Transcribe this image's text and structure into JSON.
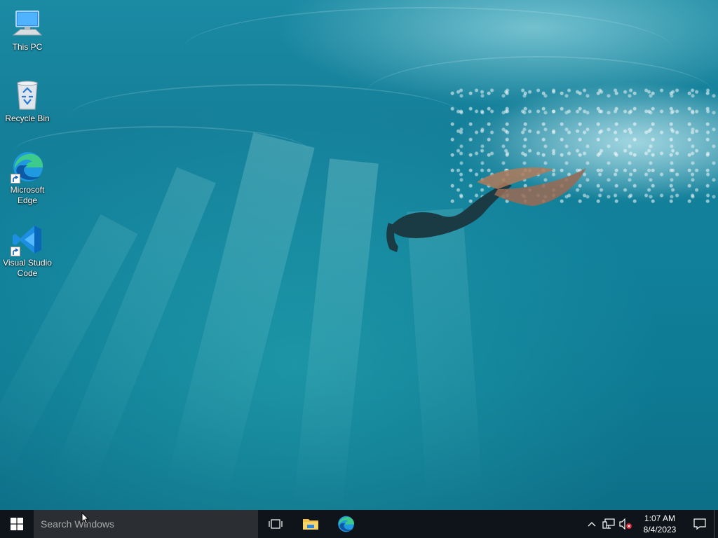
{
  "desktop": {
    "icons": [
      {
        "label": "This PC",
        "icon": "this-pc-icon"
      },
      {
        "label": "Recycle Bin",
        "icon": "recycle-bin-icon"
      },
      {
        "label": "Microsoft Edge",
        "icon": "edge-icon"
      },
      {
        "label": "Visual Studio Code",
        "icon": "vscode-icon"
      }
    ]
  },
  "taskbar": {
    "search_placeholder": "Search Windows",
    "pinned": [
      "task-view-icon",
      "file-explorer-icon",
      "edge-icon"
    ],
    "tray": {
      "icons": [
        "show-hidden-icons-chevron",
        "network-icon",
        "volume-muted-icon"
      ],
      "time": "1:07 AM",
      "date": "8/4/2023"
    },
    "notification_icon": "action-center-icon"
  },
  "colors": {
    "taskbar_bg": "#0e1419",
    "search_bg": "#2b2e32",
    "desktop_water": "#157f99",
    "windows_logo": "#ffffff"
  }
}
